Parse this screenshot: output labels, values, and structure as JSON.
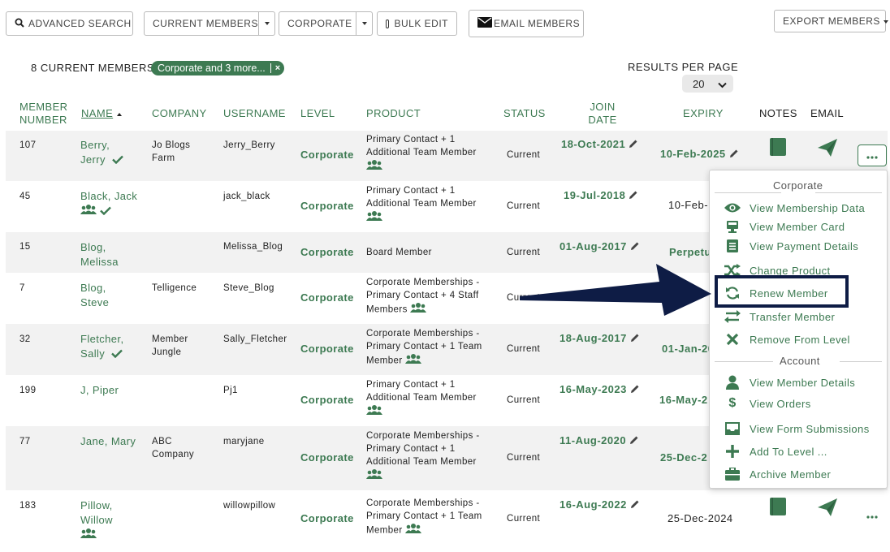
{
  "toolbar": {
    "advanced_search": "ADVANCED SEARCH",
    "current_members": "CURRENT MEMBERS",
    "corporate": "CORPORATE",
    "bulk_edit": "BULK EDIT",
    "email_members": "EMAIL MEMBERS",
    "export_members": "EXPORT MEMBERS"
  },
  "summary": {
    "count_label": "8 CURRENT MEMBERS",
    "filter_badge": "Corporate and 3 more...",
    "filter_remove": "×",
    "results_per_page_label": "RESULTS PER PAGE",
    "results_per_page_value": "20"
  },
  "table": {
    "headers": {
      "member_number_1": "MEMBER",
      "member_number_2": "NUMBER",
      "name": "NAME",
      "company": "COMPANY",
      "username": "USERNAME",
      "level": "LEVEL",
      "product": "PRODUCT",
      "status": "STATUS",
      "join_date_1": "JOIN",
      "join_date_2": "DATE",
      "expiry": "EXPIRY",
      "notes": "NOTES",
      "email": "EMAIL"
    },
    "rows": [
      {
        "number": "107",
        "name1": "Berry,",
        "name2": "Jerry",
        "company1": "Jo Blogs",
        "company2": "Farm",
        "username": "Jerry_Berry",
        "level": "Corporate",
        "product1": "Primary Contact + 1",
        "product2": "Additional Team Member",
        "product3": "",
        "status": "Current",
        "join": "18-Oct-2021",
        "expiry": "10-Feb-2025"
      },
      {
        "number": "45",
        "name1": "Black, Jack",
        "name2": "",
        "company1": "",
        "company2": "",
        "username": "jack_black",
        "level": "Corporate",
        "product1": "Primary Contact + 1",
        "product2": "Additional Team Member",
        "product3": "",
        "status": "Current",
        "join": "19-Jul-2018",
        "expiry": "10-Feb-"
      },
      {
        "number": "15",
        "name1": "Blog,",
        "name2": "Melissa",
        "company1": "",
        "company2": "",
        "username": "Melissa_Blog",
        "level": "Corporate",
        "product1": "Board Member",
        "product2": "",
        "product3": "",
        "status": "Current",
        "join": "01-Aug-2017",
        "expiry": "Perpetu"
      },
      {
        "number": "7",
        "name1": "Blog,",
        "name2": "Steve",
        "company1": "Telligence",
        "company2": "",
        "username": "Steve_Blog",
        "level": "Corporate",
        "product1": "Corporate Memberships -",
        "product2": "Primary Contact + 4 Staff",
        "product3": "Members",
        "status": "Current",
        "join": "",
        "expiry": ""
      },
      {
        "number": "32",
        "name1": "Fletcher,",
        "name2": "Sally",
        "company1": "Member",
        "company2": "Jungle",
        "username": "Sally_Fletcher",
        "level": "Corporate",
        "product1": "Corporate Memberships -",
        "product2": "Primary Contact + 1 Team",
        "product3": "Member",
        "status": "Current",
        "join": "18-Aug-2017",
        "expiry": "01-Jan-20"
      },
      {
        "number": "199",
        "name1": "J, Piper",
        "name2": "",
        "company1": "",
        "company2": "",
        "username": "Pj1",
        "level": "Corporate",
        "product1": "Primary Contact + 1",
        "product2": "Additional Team Member",
        "product3": "",
        "status": "Current",
        "join": "16-May-2023",
        "expiry": "16-May-2"
      },
      {
        "number": "77",
        "name1": "Jane, Mary",
        "name2": "",
        "company1": "ABC",
        "company2": "Company",
        "username": "maryjane",
        "level": "Corporate",
        "product1": "Corporate Memberships -",
        "product2": "Primary Contact + 1",
        "product3": "Additional Team Member",
        "status": "Current",
        "join": "11-Aug-2020",
        "expiry": "25-Dec-2"
      },
      {
        "number": "183",
        "name1": "Pillow,",
        "name2": "Willow",
        "company1": "",
        "company2": "",
        "username": "willowpillow",
        "level": "Corporate",
        "product1": "Corporate Memberships -",
        "product2": "Primary Contact + 1 Team",
        "product3": "Member",
        "status": "Current",
        "join": "16-Aug-2022",
        "expiry": "25-Dec-2024"
      }
    ]
  },
  "dropdown": {
    "section_corporate": "Corporate",
    "view_membership_data": "View Membership Data",
    "view_member_card": "View Member Card",
    "view_payment_details": "View Payment Details",
    "change_product": "Change Product",
    "renew_member": "Renew Member",
    "transfer_member": "Transfer Member",
    "remove_from_level": "Remove From Level",
    "section_account": "Account",
    "view_member_details": "View Member Details",
    "view_orders": "View Orders",
    "view_form_submissions": "View Form Submissions",
    "add_to_level": "Add To Level ...",
    "archive_member": "Archive Member"
  },
  "colors": {
    "accent": "#3d7a52",
    "callout": "#0e1c45"
  }
}
